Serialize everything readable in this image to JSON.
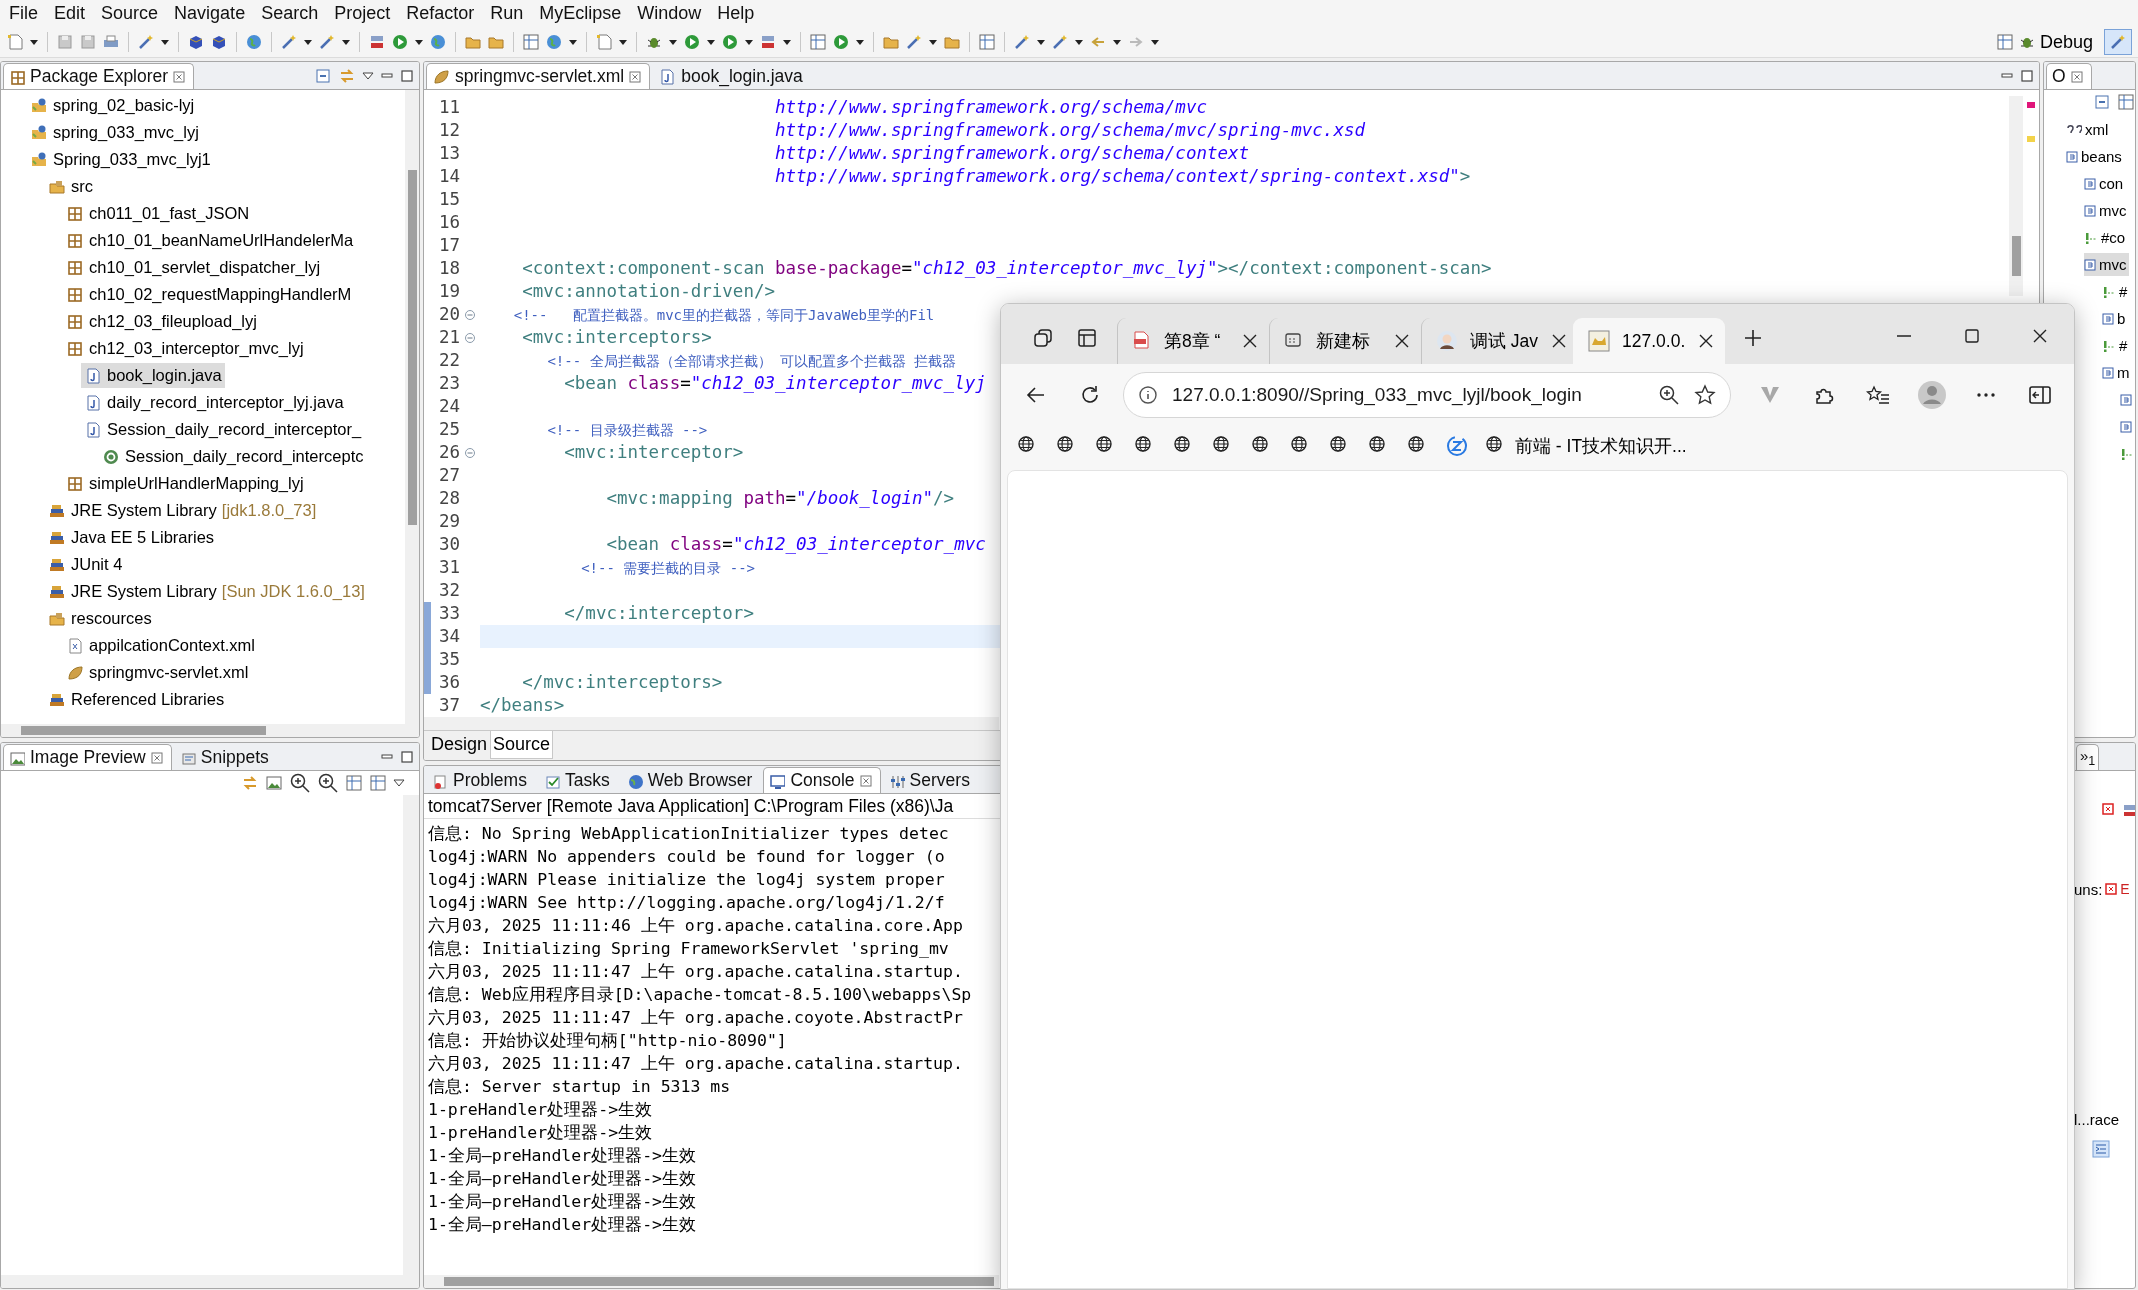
{
  "menu_bar": [
    "File",
    "Edit",
    "Source",
    "Navigate",
    "Search",
    "Project",
    "Refactor",
    "Run",
    "MyEclipse",
    "Window",
    "Help"
  ],
  "perspective": {
    "label": "Debug"
  },
  "package_explorer": {
    "title": "Package Explorer",
    "items": [
      {
        "label": "spring_02_basic-lyj",
        "kind": "project",
        "selected": false
      },
      {
        "label": "spring_033_mvc_lyj",
        "kind": "project",
        "selected": false
      },
      {
        "label": "Spring_033_mvc_lyj1",
        "kind": "project",
        "selected": false,
        "children": [
          {
            "label": "src",
            "kind": "srcfolder",
            "selected": false,
            "children": [
              {
                "label": "ch011_01_fast_JSON",
                "kind": "package",
                "selected": false
              },
              {
                "label": "ch10_01_beanNameUrlHandelerMa",
                "kind": "package",
                "selected": false
              },
              {
                "label": "ch10_01_servlet_dispatcher_lyj",
                "kind": "package",
                "selected": false
              },
              {
                "label": "ch10_02_requestMappingHandlerM",
                "kind": "package",
                "selected": false
              },
              {
                "label": "ch12_03_fileupload_lyj",
                "kind": "package",
                "selected": false
              },
              {
                "label": "ch12_03_interceptor_mvc_lyj",
                "kind": "package",
                "selected": false,
                "children": [
                  {
                    "label": "book_login.java",
                    "kind": "java",
                    "selected": true
                  },
                  {
                    "label": "daily_record_interceptor_lyj.java",
                    "kind": "java",
                    "selected": false
                  },
                  {
                    "label": "Session_daily_record_interceptor_",
                    "kind": "java",
                    "selected": false,
                    "children": [
                      {
                        "label": "Session_daily_record_interceptc",
                        "kind": "class",
                        "selected": false
                      }
                    ]
                  }
                ]
              },
              {
                "label": "simpleUrlHandlerMapping_lyj",
                "kind": "package",
                "selected": false
              }
            ]
          },
          {
            "label": "JRE System Library",
            "decoration": "[jdk1.8.0_73]",
            "kind": "library",
            "selected": false
          },
          {
            "label": "Java EE 5 Libraries",
            "kind": "library",
            "selected": false
          },
          {
            "label": "JUnit 4",
            "kind": "library",
            "selected": false
          },
          {
            "label": "JRE System Library",
            "decoration": "[Sun JDK 1.6.0_13]",
            "kind": "library",
            "selected": false
          },
          {
            "label": "rescources",
            "kind": "srcfolder",
            "selected": false,
            "children": [
              {
                "label": "appilcationContext.xml",
                "kind": "xmlfile",
                "selected": false
              },
              {
                "label": "springmvc-servlet.xml",
                "kind": "leaf",
                "selected": false
              }
            ]
          },
          {
            "label": "Referenced Libraries",
            "kind": "library",
            "selected": false
          }
        ]
      }
    ]
  },
  "image_preview": {
    "tabs": [
      {
        "label": "Image Preview",
        "kind": "image",
        "selected": true
      },
      {
        "label": "Snippets",
        "kind": "snippets",
        "selected": false
      }
    ]
  },
  "editor": {
    "tabs": [
      {
        "label": "springmvc-servlet.xml",
        "kind": "leaf",
        "selected": true
      },
      {
        "label": "book_login.java",
        "kind": "java",
        "selected": false
      }
    ],
    "lines": [
      {
        "number": "11",
        "fold": false,
        "current": false,
        "changed": false,
        "segments": [
          {
            "kind": "v",
            "text": "                            http://www.springframework.org/schema/mvc"
          }
        ]
      },
      {
        "number": "12",
        "fold": false,
        "current": false,
        "changed": false,
        "segments": [
          {
            "kind": "v",
            "text": "                            http://www.springframework.org/schema/mvc/spring-mvc.xsd"
          }
        ]
      },
      {
        "number": "13",
        "fold": false,
        "current": false,
        "changed": false,
        "segments": [
          {
            "kind": "v",
            "text": "                            http://www.springframework.org/schema/context"
          }
        ]
      },
      {
        "number": "14",
        "fold": false,
        "current": false,
        "changed": false,
        "segments": [
          {
            "kind": "v",
            "text": "                            http://www.springframework.org/schema/context/spring-context.xsd\""
          },
          {
            "kind": "t",
            "text": ">"
          }
        ]
      },
      {
        "number": "15",
        "fold": false,
        "current": false,
        "changed": false
      },
      {
        "number": "16",
        "fold": false,
        "current": false,
        "changed": false
      },
      {
        "number": "17",
        "fold": false,
        "current": false,
        "changed": false
      },
      {
        "number": "18",
        "fold": false,
        "current": false,
        "changed": false,
        "segments": [
          {
            "kind": "t",
            "text": "    <context:component-scan "
          },
          {
            "kind": "a",
            "text": "base-package"
          },
          {
            "kind": "p",
            "text": "="
          },
          {
            "kind": "v",
            "text": "\"ch12_03_interceptor_mvc_lyj\""
          },
          {
            "kind": "t",
            "text": "></context:component-scan>"
          }
        ]
      },
      {
        "number": "19",
        "fold": false,
        "current": false,
        "changed": false,
        "segments": [
          {
            "kind": "t",
            "text": "    <mvc:annotation-driven/>"
          }
        ]
      },
      {
        "number": "20",
        "fold": true,
        "current": false,
        "changed": false,
        "segments": [
          {
            "kind": "c",
            "text": "    <!--   配置拦截器。mvc里的拦截器，等同于JavaWeb里学的Fil"
          }
        ]
      },
      {
        "number": "21",
        "fold": true,
        "current": false,
        "changed": false,
        "segments": [
          {
            "kind": "t",
            "text": "    <mvc:interceptors>"
          }
        ]
      },
      {
        "number": "22",
        "fold": false,
        "current": false,
        "changed": false,
        "segments": [
          {
            "kind": "c",
            "text": "        <!-- 全局拦截器（全部请求拦截） 可以配置多个拦截器 拦截器"
          }
        ]
      },
      {
        "number": "23",
        "fold": false,
        "current": false,
        "changed": false,
        "segments": [
          {
            "kind": "t",
            "text": "        <bean "
          },
          {
            "kind": "a",
            "text": "class"
          },
          {
            "kind": "p",
            "text": "="
          },
          {
            "kind": "v",
            "text": "\"ch12_03_interceptor_mvc_lyj"
          }
        ]
      },
      {
        "number": "24",
        "fold": false,
        "current": false,
        "changed": false
      },
      {
        "number": "25",
        "fold": false,
        "current": false,
        "changed": false,
        "segments": [
          {
            "kind": "c",
            "text": "        <!-- 目录级拦截器 -->"
          }
        ]
      },
      {
        "number": "26",
        "fold": true,
        "current": false,
        "changed": false,
        "segments": [
          {
            "kind": "t",
            "text": "        <mvc:interceptor>"
          }
        ]
      },
      {
        "number": "27",
        "fold": false,
        "current": false,
        "changed": false
      },
      {
        "number": "28",
        "fold": false,
        "current": false,
        "changed": false,
        "segments": [
          {
            "kind": "t",
            "text": "            <mvc:mapping "
          },
          {
            "kind": "a",
            "text": "path"
          },
          {
            "kind": "p",
            "text": "="
          },
          {
            "kind": "v",
            "text": "\"/book_login\""
          },
          {
            "kind": "t",
            "text": "/>"
          }
        ]
      },
      {
        "number": "29",
        "fold": false,
        "current": false,
        "changed": false
      },
      {
        "number": "30",
        "fold": false,
        "current": false,
        "changed": false,
        "segments": [
          {
            "kind": "t",
            "text": "            <bean "
          },
          {
            "kind": "a",
            "text": "class"
          },
          {
            "kind": "p",
            "text": "="
          },
          {
            "kind": "v",
            "text": "\"ch12_03_interceptor_mvc"
          }
        ]
      },
      {
        "number": "31",
        "fold": false,
        "current": false,
        "changed": false,
        "segments": [
          {
            "kind": "c",
            "text": "            <!-- 需要拦截的目录 -->"
          }
        ]
      },
      {
        "number": "32",
        "fold": false,
        "current": false,
        "changed": false
      },
      {
        "number": "33",
        "fold": false,
        "current": false,
        "changed": true,
        "segments": [
          {
            "kind": "t",
            "text": "        </mvc:interceptor>"
          }
        ]
      },
      {
        "number": "34",
        "fold": false,
        "current": true,
        "changed": true
      },
      {
        "number": "35",
        "fold": false,
        "current": false,
        "changed": true
      },
      {
        "number": "36",
        "fold": false,
        "current": false,
        "changed": true,
        "segments": [
          {
            "kind": "t",
            "text": "    </mvc:interceptors>"
          }
        ]
      },
      {
        "number": "37",
        "fold": false,
        "current": false,
        "changed": false,
        "segments": [
          {
            "kind": "t",
            "text": "</beans>"
          }
        ]
      }
    ],
    "mode_tabs": [
      {
        "label": "Design",
        "selected": false
      },
      {
        "label": "Source",
        "selected": true
      }
    ]
  },
  "console": {
    "tabs": [
      {
        "label": "Problems",
        "kind": "problems",
        "selected": false
      },
      {
        "label": "Tasks",
        "kind": "tasks",
        "selected": false
      },
      {
        "label": "Web Browser",
        "kind": "web",
        "selected": false
      },
      {
        "label": "Console",
        "kind": "console",
        "selected": true
      },
      {
        "label": "Servers",
        "kind": "servers",
        "selected": false
      }
    ],
    "title": "tomcat7Server [Remote Java Application] C:\\Program Files (x86)\\Ja",
    "lines": [
      "信息: No Spring WebApplicationInitializer types detec",
      "log4j:WARN No appenders could be found for logger (o",
      "log4j:WARN Please initialize the log4j system proper",
      "log4j:WARN See http://logging.apache.org/log4j/1.2/f",
      "六月03, 2025 11:11:46 上午 org.apache.catalina.core.App",
      "信息: Initializing Spring FrameworkServlet 'spring_mv",
      "六月03, 2025 11:11:47 上午 org.apache.catalina.startup.",
      "信息: Web应用程序目录[D:\\apache-tomcat-8.5.100\\webapps\\Sp",
      "六月03, 2025 11:11:47 上午 org.apache.coyote.AbstractPr",
      "信息: 开始协议处理句柄[\"http-nio-8090\"]",
      "六月03, 2025 11:11:47 上午 org.apache.catalina.startup.",
      "信息: Server startup in 5313 ms",
      "1-preHandler处理器->生效",
      "1-preHandler处理器->生效",
      "1-全局—preHandler处理器->生效",
      "1-全局—preHandler处理器->生效",
      "1-全局—preHandler处理器->生效",
      "1-全局—preHandler处理器->生效"
    ]
  },
  "outline": {
    "title": "O",
    "items": [
      {
        "label": "xml",
        "kind": "pi",
        "selected": false
      },
      {
        "label": "beans",
        "kind": "element",
        "selected": false,
        "children": [
          {
            "label": "con",
            "kind": "element",
            "selected": false
          },
          {
            "label": "mvc",
            "kind": "element",
            "selected": false
          },
          {
            "label": "#co",
            "kind": "comment",
            "selected": false
          },
          {
            "label": "mvc",
            "kind": "element",
            "selected": true,
            "children": [
              {
                "label": "#",
                "kind": "comment",
                "selected": false
              },
              {
                "label": "b",
                "kind": "element",
                "selected": false
              },
              {
                "label": "#",
                "kind": "comment",
                "selected": false
              },
              {
                "label": "m",
                "kind": "element",
                "selected": false,
                "children": [
                  {
                    "kind": "element",
                    "selected": false
                  },
                  {
                    "kind": "element",
                    "selected": false
                  },
                  {
                    "kind": "comment",
                    "selected": false
                  }
                ]
              }
            ]
          }
        ]
      }
    ]
  },
  "debug_panel": {
    "tab": "»$_{1}$",
    "label": "uns:",
    "badge": "E",
    "item": "l...race"
  },
  "browser": {
    "tabs": [
      {
        "label": "第8章 “",
        "kind": "pdf",
        "selected": false
      },
      {
        "label": "新建标",
        "kind": "newtab",
        "selected": false
      },
      {
        "label": "调试 Jav",
        "kind": "avatar",
        "selected": false
      },
      {
        "label": "127.0.0.",
        "kind": "cat",
        "selected": true
      }
    ],
    "address": "127.0.0.1:8090//Spring_033_mvc_lyjl/book_login",
    "favorites": [
      {
        "kind": "globe"
      },
      {
        "kind": "globe"
      },
      {
        "kind": "globe"
      },
      {
        "kind": "globe"
      },
      {
        "kind": "globe"
      },
      {
        "kind": "globe"
      },
      {
        "kind": "globe"
      },
      {
        "kind": "globe"
      },
      {
        "kind": "globe"
      },
      {
        "kind": "globe"
      },
      {
        "kind": "globe"
      },
      {
        "kind": "z"
      },
      {
        "kind": "globe",
        "label": "前端 - IT技术知识开..."
      }
    ]
  }
}
